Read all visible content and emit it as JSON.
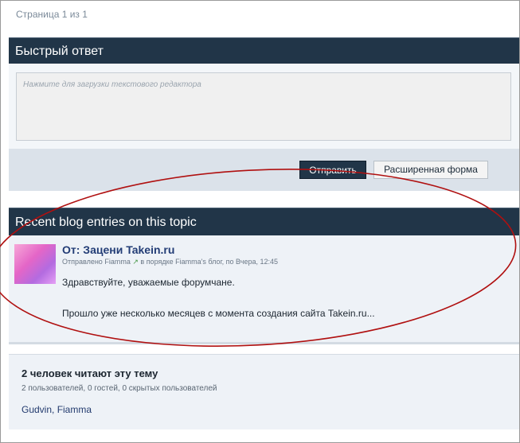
{
  "pagination": {
    "text": "Страница 1 из 1"
  },
  "quick_reply": {
    "title": "Быстрый ответ",
    "editor_placeholder": "Нажмите для загрузки текстового редактора",
    "send_label": "Отправить",
    "advanced_label": "Расширенная форма"
  },
  "blog": {
    "title": "Recent blog entries on this topic",
    "entry": {
      "title": "От: Зацени Takein.ru",
      "meta": {
        "prefix": "Отправлено ",
        "author": "Fiamma",
        "middle": " в порядке ",
        "blog_name": "Fiamma's блог",
        "suffix": ", по Вчера, 12:45"
      },
      "text_line1": "Здравствуйте, уважаемые форумчане.",
      "text_line2": "Прошло уже несколько месяцев с момента создания сайта Takein.ru..."
    }
  },
  "readers": {
    "title": "2 человек читают эту тему",
    "subtitle": "2 пользователей, 0 гостей, 0 скрытых пользователей",
    "names": "Gudvin, Fiamma"
  },
  "colors": {
    "header_bg": "#213548",
    "annotation_stroke": "#b01010"
  }
}
